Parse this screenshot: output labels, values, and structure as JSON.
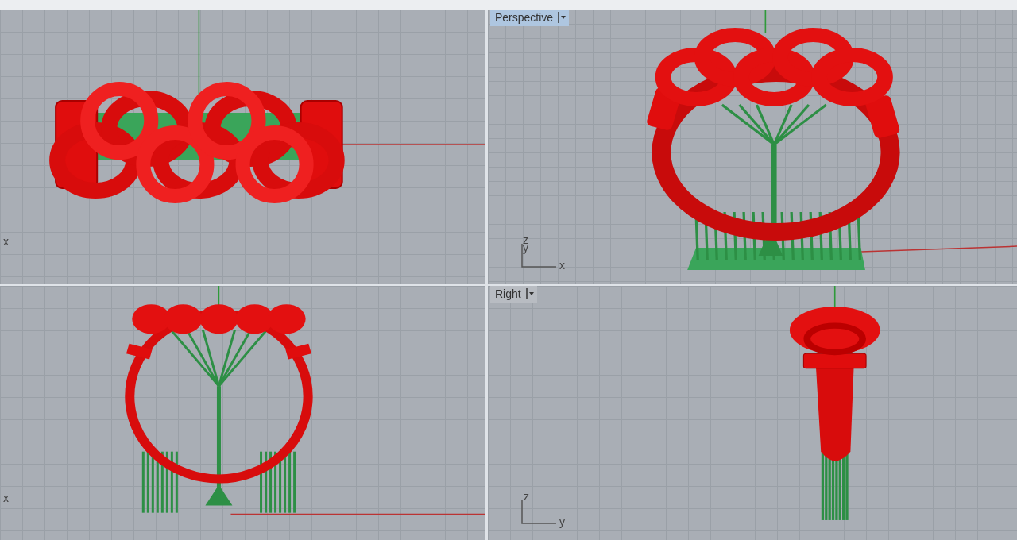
{
  "viewports": [
    {
      "kind": "top",
      "axis_labels": [
        "x"
      ]
    },
    {
      "kind": "perspective",
      "selected": true,
      "title": "Perspective",
      "axis_labels": [
        "z",
        "y",
        "x"
      ]
    },
    {
      "kind": "front",
      "axis_labels": [
        "x"
      ]
    },
    {
      "kind": "right",
      "selected": false,
      "title": "Right",
      "axis_labels": [
        "z",
        "y"
      ]
    }
  ]
}
